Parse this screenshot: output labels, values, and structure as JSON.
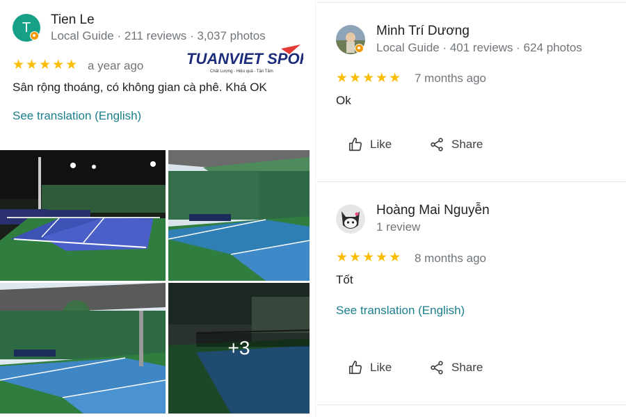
{
  "reviews": [
    {
      "name": "Tien Le",
      "avatar_letter": "T",
      "meta": "Local Guide · 211 reviews · 3,037 photos",
      "rating": 5,
      "stars": "★★★★★",
      "time": "a year ago",
      "text": "Sân rộng thoáng, có không gian cà phê. Khá OK",
      "translation_link": "See translation (English)",
      "photos_more": "+3"
    },
    {
      "name": "Minh Trí Dương",
      "meta": "Local Guide · 401 reviews · 624 photos",
      "rating": 5,
      "stars": "★★★★★",
      "time": "7 months ago",
      "text": "Ok",
      "like_label": "Like",
      "share_label": "Share"
    },
    {
      "name": "Hoàng Mai Nguyễn",
      "meta": "1 review",
      "rating": 5,
      "stars": "★★★★★",
      "time": "8 months ago",
      "text": "Tốt",
      "translation_link": "See translation (English)",
      "like_label": "Like",
      "share_label": "Share"
    }
  ],
  "watermark": {
    "brand": "TUANVIET SPORT",
    "tagline": "Chất Lượng - Hiệu quả - Tận Tâm"
  },
  "colors": {
    "star": "#fbbc04",
    "link": "#1a73e8",
    "guide_badge": "#f29900",
    "avatar_teal": "#16a085",
    "court_blue": "#3f7fd0",
    "court_green": "#2f7d3f"
  }
}
